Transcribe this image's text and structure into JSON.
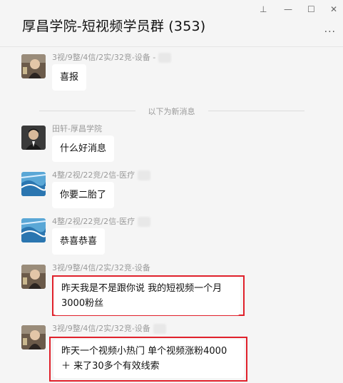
{
  "window": {
    "title": "厚昌学院-短视频学员群 (353)",
    "controls": {
      "pin": "⊥",
      "minimize": "—",
      "maximize": "☐",
      "close": "✕"
    },
    "more": "···"
  },
  "divider": "以下为新消息",
  "messages": [
    {
      "sender": "3视/9整/4信/2实/32竞-设备 -",
      "text": "喜报"
    },
    {
      "sender": "田轩-厚昌学院",
      "text": "什么好消息"
    },
    {
      "sender": "4整/2视/22竞/2信-医疗",
      "text": "你要二胎了"
    },
    {
      "sender": "4整/2视/22竞/2信-医疗",
      "text": "恭喜恭喜"
    },
    {
      "sender": "3视/9整/4信/2实/32竞-设备",
      "text": "昨天我是不是跟你说 我的短视频一个月3000粉丝"
    },
    {
      "sender": "3视/9整/4信/2实/32竞-设备",
      "text": "昨天一个视频小热门  单个视频涨粉4000＋ 来了30多个有效线索"
    }
  ],
  "colors": {
    "highlight": "#e0212b",
    "bubble": "#ffffff",
    "background": "#f5f5f5"
  }
}
